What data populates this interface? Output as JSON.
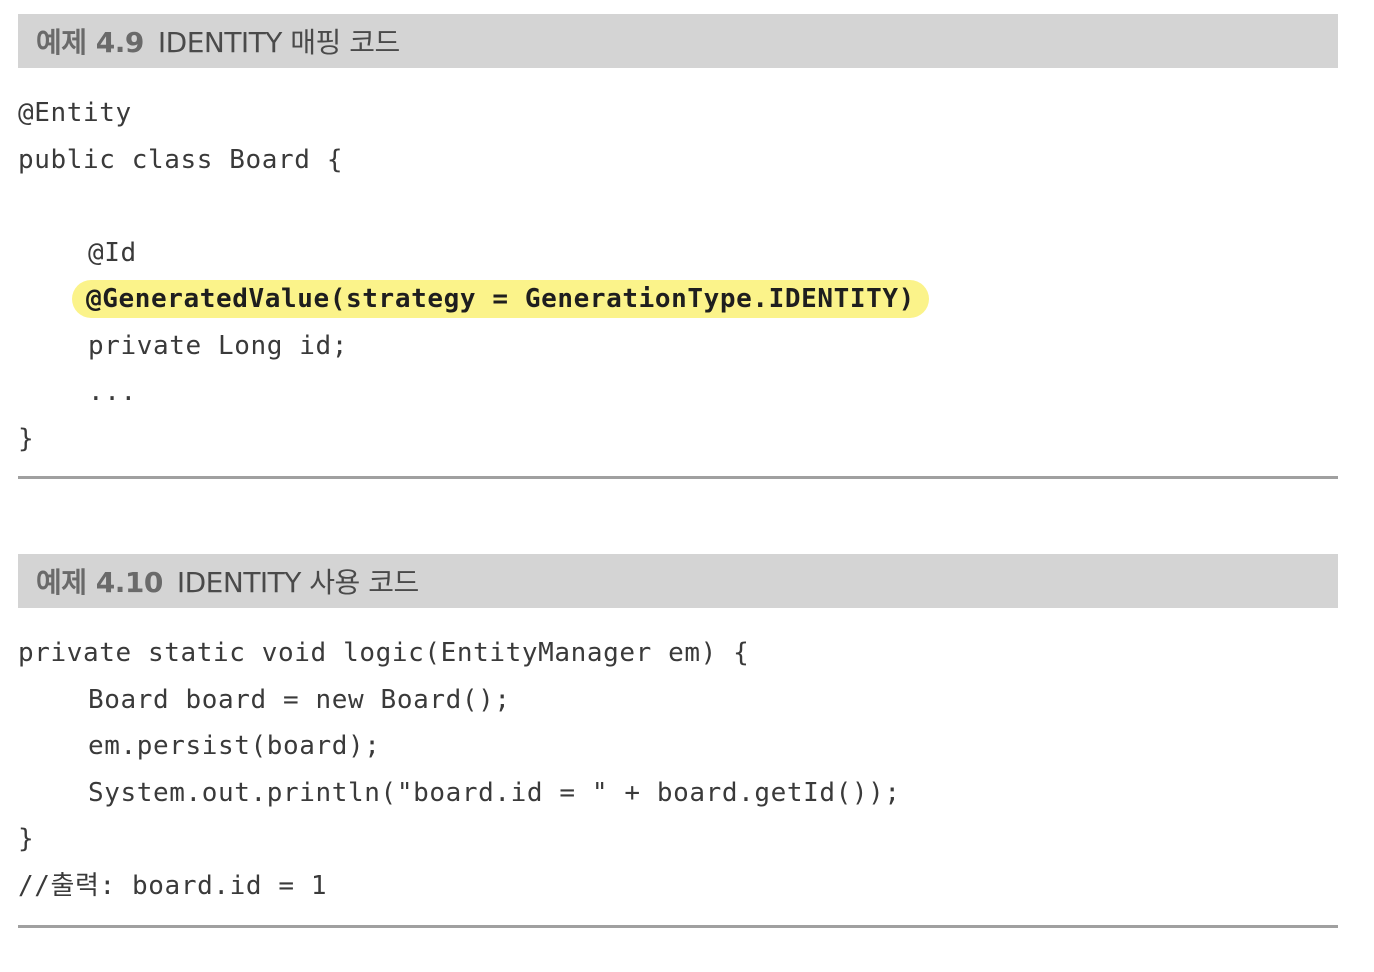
{
  "example1": {
    "number": "예제 4.9",
    "title": "IDENTITY 매핑 코드",
    "lines": [
      "@Entity",
      "public class Board {",
      "",
      "@Id",
      "@GeneratedValue(strategy = GenerationType.IDENTITY)",
      "private Long id;",
      "...",
      "}"
    ]
  },
  "example2": {
    "number": "예제 4.10",
    "title": "IDENTITY 사용 코드",
    "lines": [
      "private static void logic(EntityManager em) {",
      "Board board = new Board();",
      "em.persist(board);",
      "System.out.println(\"board.id = \" + board.getId());",
      "}",
      "//출력: board.id = 1"
    ]
  },
  "colors": {
    "caption_bg": "#d4d4d4",
    "highlight": "#fbf38a",
    "rule": "#a0a0a0"
  }
}
